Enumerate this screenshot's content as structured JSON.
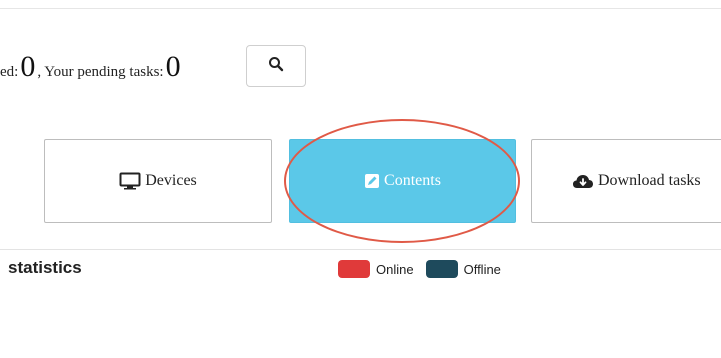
{
  "summary": {
    "processed_prefix": "ed:",
    "processed_count": "0",
    "pending_label": ", Your pending tasks:",
    "pending_count": "0"
  },
  "search_button": {
    "icon": "search-icon"
  },
  "tiles": [
    {
      "label": "Devices",
      "icon": "monitor-icon"
    },
    {
      "label": "Contents",
      "icon": "edit-icon"
    },
    {
      "label": "Download tasks",
      "icon": "cloud-download-icon"
    }
  ],
  "statistics": {
    "title": "statistics",
    "legend": [
      {
        "label": "Online",
        "color": "#e03a3a"
      },
      {
        "label": "Offline",
        "color": "#1e4a5c"
      }
    ]
  },
  "colors": {
    "active_tile": "#5bc8e8",
    "annotation": "#e05a47"
  }
}
